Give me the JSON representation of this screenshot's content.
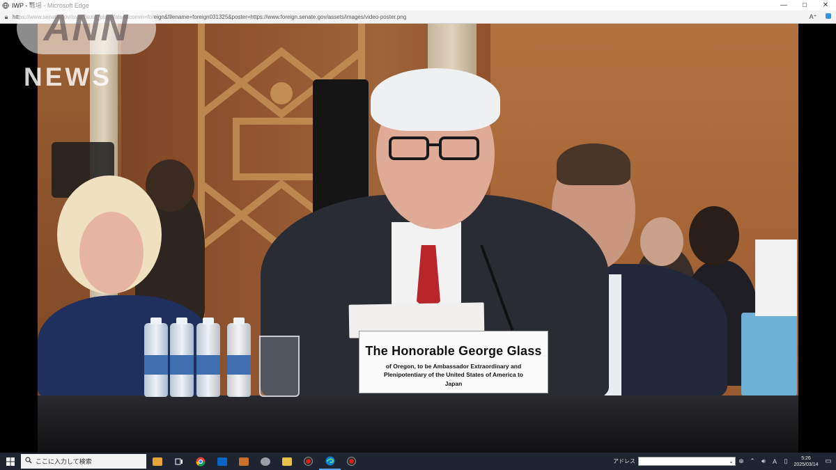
{
  "window": {
    "title": "IWP - 職場 - Microsoft Edge",
    "url": "https://www.senate.gov/isvp/?auto_play=false&comm=foreign&filename=foreign031325&poster=https://www.foreign.senate.gov/assets/images/video-poster.png",
    "minimize_glyph": "—",
    "maximize_glyph": "□",
    "close_glyph": "✕"
  },
  "watermark": {
    "logo_top": "ANN",
    "logo_bottom": "NEWS"
  },
  "nameplate": {
    "name": "The Honorable George Glass",
    "line1": "of Oregon, to be Ambassador Extraordinary and",
    "line2": "Plenipotentiary of the United States of America to",
    "country": "Japan"
  },
  "taskbar": {
    "search_placeholder": "ここに入力して検索",
    "address_label": "アドレス",
    "time": "5:26",
    "date": "2025/03/14"
  },
  "icons": {
    "start": "windows-start-icon",
    "search": "search-icon",
    "taskview": "task-view-icon",
    "chrome": "chrome-icon",
    "outlook": "outlook-icon",
    "edge": "edge-icon",
    "record": "record-icon"
  },
  "colors": {
    "taskbar": "#1f2530",
    "edge_accent": "#0a7fd0",
    "record_red": "#e21b1b"
  }
}
